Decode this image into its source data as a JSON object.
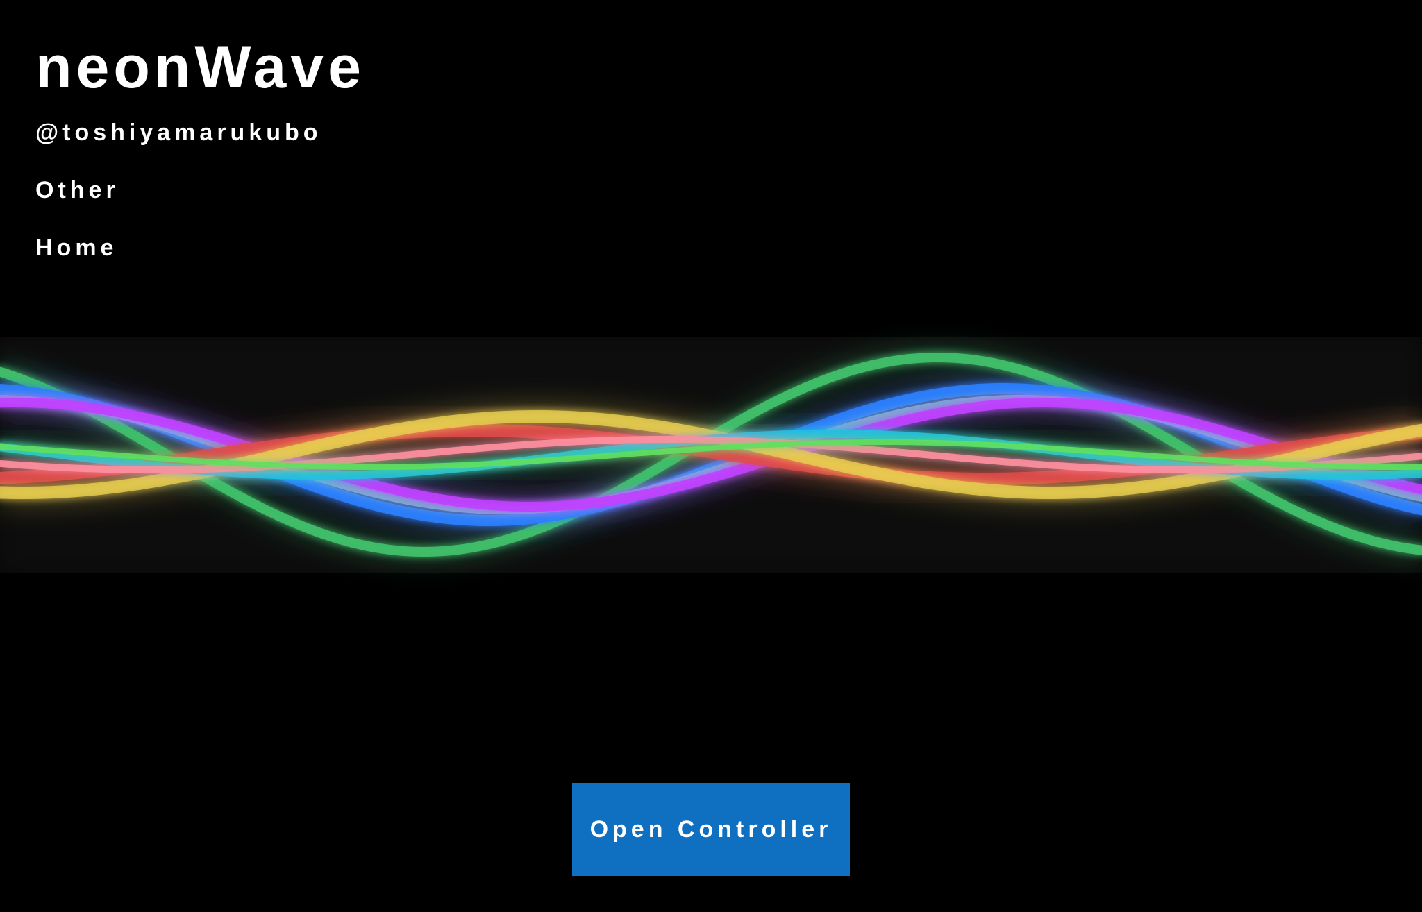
{
  "site": {
    "title": "neonWave",
    "author_link": "@toshiyamarukubo",
    "nav": [
      {
        "label": "Other"
      },
      {
        "label": "Home"
      }
    ]
  },
  "controller": {
    "button_label": "Open Controller"
  },
  "theme": {
    "background": "#000000",
    "text": "#ffffff",
    "button_bg": "#0f6fc0"
  },
  "wave_visual": {
    "strand_colors": [
      "#3fbf6a",
      "#2a7fff",
      "#7fb3d8",
      "#c040ff",
      "#e04a4a",
      "#e8d050",
      "#20c0e0",
      "#ff8fa0",
      "#60e060"
    ]
  }
}
